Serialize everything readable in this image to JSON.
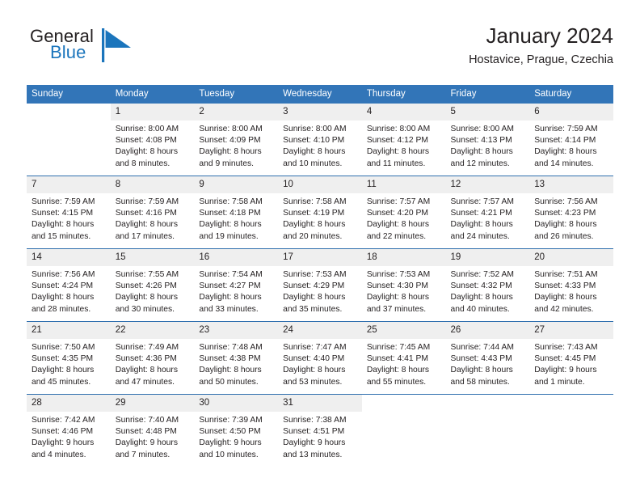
{
  "brand": {
    "word1": "General",
    "word2": "Blue",
    "flag_icon": "triangle-flag-icon",
    "color_dark": "#231f20",
    "color_blue": "#1b75bc"
  },
  "header": {
    "title": "January 2024",
    "location": "Hostavice, Prague, Czechia"
  },
  "theme": {
    "header_row_bg": "#3275b8",
    "day_number_bg": "#efefef",
    "row_divider": "#2f6fae",
    "text": "#231f20"
  },
  "weekday_headers": [
    "Sunday",
    "Monday",
    "Tuesday",
    "Wednesday",
    "Thursday",
    "Friday",
    "Saturday"
  ],
  "weeks": [
    [
      {
        "day": "",
        "blank": true,
        "lines": []
      },
      {
        "day": "1",
        "lines": [
          "Sunrise: 8:00 AM",
          "Sunset: 4:08 PM",
          "Daylight: 8 hours",
          "and 8 minutes."
        ]
      },
      {
        "day": "2",
        "lines": [
          "Sunrise: 8:00 AM",
          "Sunset: 4:09 PM",
          "Daylight: 8 hours",
          "and 9 minutes."
        ]
      },
      {
        "day": "3",
        "lines": [
          "Sunrise: 8:00 AM",
          "Sunset: 4:10 PM",
          "Daylight: 8 hours",
          "and 10 minutes."
        ]
      },
      {
        "day": "4",
        "lines": [
          "Sunrise: 8:00 AM",
          "Sunset: 4:12 PM",
          "Daylight: 8 hours",
          "and 11 minutes."
        ]
      },
      {
        "day": "5",
        "lines": [
          "Sunrise: 8:00 AM",
          "Sunset: 4:13 PM",
          "Daylight: 8 hours",
          "and 12 minutes."
        ]
      },
      {
        "day": "6",
        "lines": [
          "Sunrise: 7:59 AM",
          "Sunset: 4:14 PM",
          "Daylight: 8 hours",
          "and 14 minutes."
        ]
      }
    ],
    [
      {
        "day": "7",
        "lines": [
          "Sunrise: 7:59 AM",
          "Sunset: 4:15 PM",
          "Daylight: 8 hours",
          "and 15 minutes."
        ]
      },
      {
        "day": "8",
        "lines": [
          "Sunrise: 7:59 AM",
          "Sunset: 4:16 PM",
          "Daylight: 8 hours",
          "and 17 minutes."
        ]
      },
      {
        "day": "9",
        "lines": [
          "Sunrise: 7:58 AM",
          "Sunset: 4:18 PM",
          "Daylight: 8 hours",
          "and 19 minutes."
        ]
      },
      {
        "day": "10",
        "lines": [
          "Sunrise: 7:58 AM",
          "Sunset: 4:19 PM",
          "Daylight: 8 hours",
          "and 20 minutes."
        ]
      },
      {
        "day": "11",
        "lines": [
          "Sunrise: 7:57 AM",
          "Sunset: 4:20 PM",
          "Daylight: 8 hours",
          "and 22 minutes."
        ]
      },
      {
        "day": "12",
        "lines": [
          "Sunrise: 7:57 AM",
          "Sunset: 4:21 PM",
          "Daylight: 8 hours",
          "and 24 minutes."
        ]
      },
      {
        "day": "13",
        "lines": [
          "Sunrise: 7:56 AM",
          "Sunset: 4:23 PM",
          "Daylight: 8 hours",
          "and 26 minutes."
        ]
      }
    ],
    [
      {
        "day": "14",
        "lines": [
          "Sunrise: 7:56 AM",
          "Sunset: 4:24 PM",
          "Daylight: 8 hours",
          "and 28 minutes."
        ]
      },
      {
        "day": "15",
        "lines": [
          "Sunrise: 7:55 AM",
          "Sunset: 4:26 PM",
          "Daylight: 8 hours",
          "and 30 minutes."
        ]
      },
      {
        "day": "16",
        "lines": [
          "Sunrise: 7:54 AM",
          "Sunset: 4:27 PM",
          "Daylight: 8 hours",
          "and 33 minutes."
        ]
      },
      {
        "day": "17",
        "lines": [
          "Sunrise: 7:53 AM",
          "Sunset: 4:29 PM",
          "Daylight: 8 hours",
          "and 35 minutes."
        ]
      },
      {
        "day": "18",
        "lines": [
          "Sunrise: 7:53 AM",
          "Sunset: 4:30 PM",
          "Daylight: 8 hours",
          "and 37 minutes."
        ]
      },
      {
        "day": "19",
        "lines": [
          "Sunrise: 7:52 AM",
          "Sunset: 4:32 PM",
          "Daylight: 8 hours",
          "and 40 minutes."
        ]
      },
      {
        "day": "20",
        "lines": [
          "Sunrise: 7:51 AM",
          "Sunset: 4:33 PM",
          "Daylight: 8 hours",
          "and 42 minutes."
        ]
      }
    ],
    [
      {
        "day": "21",
        "lines": [
          "Sunrise: 7:50 AM",
          "Sunset: 4:35 PM",
          "Daylight: 8 hours",
          "and 45 minutes."
        ]
      },
      {
        "day": "22",
        "lines": [
          "Sunrise: 7:49 AM",
          "Sunset: 4:36 PM",
          "Daylight: 8 hours",
          "and 47 minutes."
        ]
      },
      {
        "day": "23",
        "lines": [
          "Sunrise: 7:48 AM",
          "Sunset: 4:38 PM",
          "Daylight: 8 hours",
          "and 50 minutes."
        ]
      },
      {
        "day": "24",
        "lines": [
          "Sunrise: 7:47 AM",
          "Sunset: 4:40 PM",
          "Daylight: 8 hours",
          "and 53 minutes."
        ]
      },
      {
        "day": "25",
        "lines": [
          "Sunrise: 7:45 AM",
          "Sunset: 4:41 PM",
          "Daylight: 8 hours",
          "and 55 minutes."
        ]
      },
      {
        "day": "26",
        "lines": [
          "Sunrise: 7:44 AM",
          "Sunset: 4:43 PM",
          "Daylight: 8 hours",
          "and 58 minutes."
        ]
      },
      {
        "day": "27",
        "lines": [
          "Sunrise: 7:43 AM",
          "Sunset: 4:45 PM",
          "Daylight: 9 hours",
          "and 1 minute."
        ]
      }
    ],
    [
      {
        "day": "28",
        "lines": [
          "Sunrise: 7:42 AM",
          "Sunset: 4:46 PM",
          "Daylight: 9 hours",
          "and 4 minutes."
        ]
      },
      {
        "day": "29",
        "lines": [
          "Sunrise: 7:40 AM",
          "Sunset: 4:48 PM",
          "Daylight: 9 hours",
          "and 7 minutes."
        ]
      },
      {
        "day": "30",
        "lines": [
          "Sunrise: 7:39 AM",
          "Sunset: 4:50 PM",
          "Daylight: 9 hours",
          "and 10 minutes."
        ]
      },
      {
        "day": "31",
        "lines": [
          "Sunrise: 7:38 AM",
          "Sunset: 4:51 PM",
          "Daylight: 9 hours",
          "and 13 minutes."
        ]
      },
      {
        "day": "",
        "blank": true,
        "lines": []
      },
      {
        "day": "",
        "blank": true,
        "lines": []
      },
      {
        "day": "",
        "blank": true,
        "lines": []
      }
    ]
  ]
}
